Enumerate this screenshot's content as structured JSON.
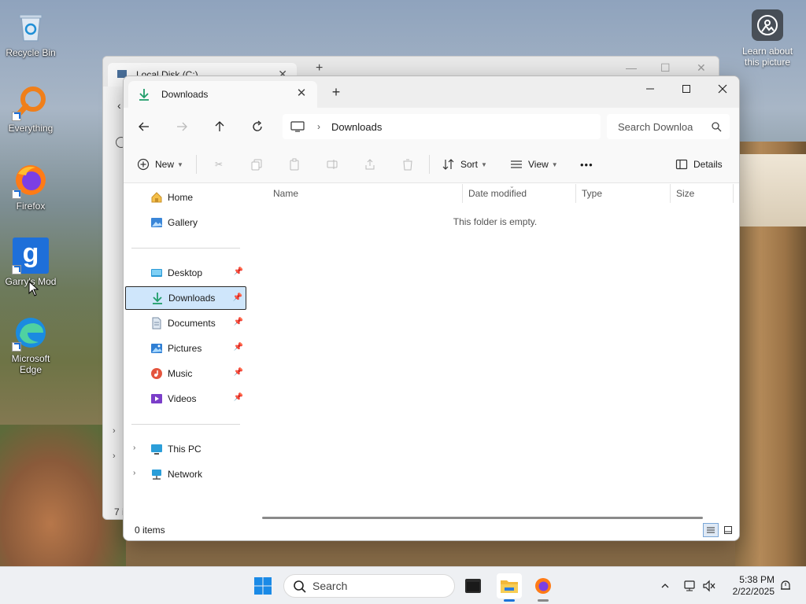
{
  "desktop": {
    "icons": [
      {
        "label": "Recycle Bin"
      },
      {
        "label": "Everything"
      },
      {
        "label": "Firefox"
      },
      {
        "label": "Garry's Mod"
      },
      {
        "label": "Microsoft Edge"
      }
    ],
    "learn_label": "Learn about this picture"
  },
  "back_window": {
    "tab_title": "Local Disk (C:)",
    "status_fragment": "7 i"
  },
  "window": {
    "tab_title": "Downloads",
    "address": {
      "segment": "Downloads"
    },
    "search": {
      "placeholder": "Search Downloa"
    },
    "toolbar": {
      "new_label": "New",
      "sort_label": "Sort",
      "view_label": "View",
      "more_label": "•••",
      "details_label": "Details"
    },
    "sidebar": {
      "home": "Home",
      "gallery": "Gallery",
      "desktop": "Desktop",
      "downloads": "Downloads",
      "documents": "Documents",
      "pictures": "Pictures",
      "music": "Music",
      "videos": "Videos",
      "this_pc": "This PC",
      "network": "Network"
    },
    "columns": {
      "name": "Name",
      "date_modified": "Date modified",
      "type": "Type",
      "size": "Size"
    },
    "empty_message": "This folder is empty.",
    "status": {
      "item_count": "0 items"
    }
  },
  "taskbar": {
    "search_label": "Search",
    "time": "5:38 PM",
    "date": "2/22/2025"
  },
  "colors": {
    "accent": "#0067c0",
    "selection": "#cfe6fb",
    "download_green": "#1f9d6a"
  }
}
